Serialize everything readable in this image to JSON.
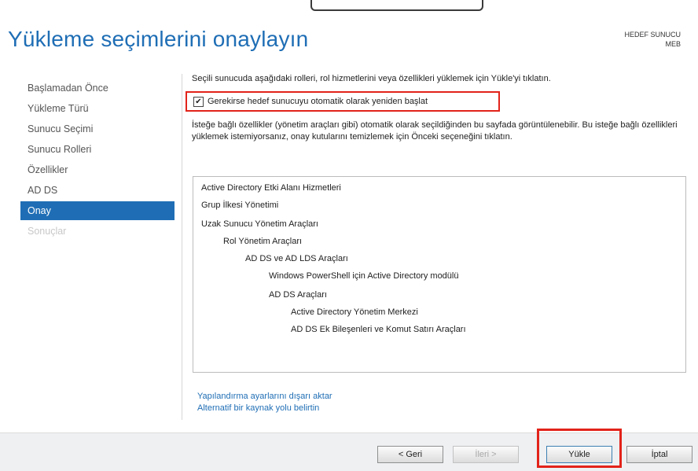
{
  "page": {
    "title": "Yükleme seçimlerini onaylayın",
    "destination_label": "HEDEF SUNUCU",
    "destination_value": "MEB"
  },
  "nav": {
    "items": [
      {
        "label": "Başlamadan Önce"
      },
      {
        "label": "Yükleme Türü"
      },
      {
        "label": "Sunucu Seçimi"
      },
      {
        "label": "Sunucu Rolleri"
      },
      {
        "label": "Özellikler"
      },
      {
        "label": "AD DS"
      },
      {
        "label": "Onay"
      },
      {
        "label": "Sonuçlar"
      }
    ],
    "selected": "Onay"
  },
  "content": {
    "intro": "Seçili sunucuda aşağıdaki rolleri, rol hizmetlerini veya özellikleri yüklemek için Yükle'yi tıklatın.",
    "restart_label": "Gerekirse hedef sunucuyu otomatik olarak yeniden başlat",
    "restart_checked": true,
    "optional_note": "İsteğe bağlı özellikler (yönetim araçları gibi) otomatik olarak seçildiğinden bu sayfada görüntülenebilir. Bu isteğe bağlı özellikleri yüklemek istemiyorsanız, onay kutularını temizlemek için Önceki seçeneğini tıklatın.",
    "features": [
      {
        "label": "Active Directory Etki Alanı Hizmetleri",
        "level": 0
      },
      {
        "label": "Grup İlkesi Yönetimi",
        "level": 0
      },
      {
        "label": "Uzak Sunucu Yönetim Araçları",
        "level": 0
      },
      {
        "label": "Rol Yönetim Araçları",
        "level": 1
      },
      {
        "label": "AD DS ve AD LDS Araçları",
        "level": 2
      },
      {
        "label": "Windows PowerShell için Active Directory modülü",
        "level": 3
      },
      {
        "label": "AD DS Araçları",
        "level": 3
      },
      {
        "label": "Active Directory Yönetim Merkezi",
        "level": 4
      },
      {
        "label": "AD DS Ek Bileşenleri ve Komut Satırı Araçları",
        "level": 4
      }
    ],
    "link_export": "Yapılandırma ayarlarını dışarı aktar",
    "link_source": "Alternatif bir kaynak yolu belirtin"
  },
  "footer": {
    "back": "< Geri",
    "next": "İleri >",
    "install": "Yükle",
    "cancel": "İptal"
  },
  "colors": {
    "accent": "#1f6eb5",
    "highlight": "#e2231a"
  }
}
